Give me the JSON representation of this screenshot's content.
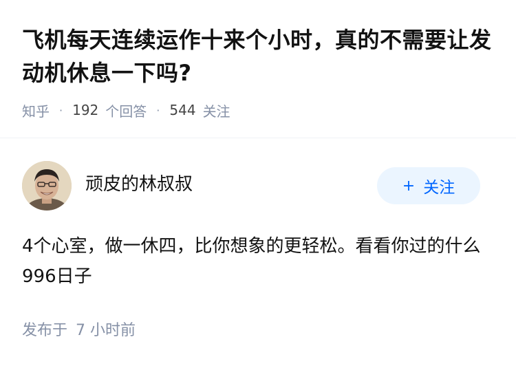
{
  "question": {
    "title": "飞机每天连续运作十来个小时，真的不需要让发动机休息一下吗?",
    "source": "知乎",
    "answers_count": "192",
    "answers_label": "个回答",
    "followers_count": "544",
    "followers_label": "关注"
  },
  "answer": {
    "author_name": "顽皮的林叔叔",
    "follow_button_label": "关注",
    "follow_button_icon": "plus-icon",
    "content": "4个心室，做一休四，比你想象的更轻松。看看你过的什么996日子",
    "time_prefix": "发布于",
    "time_value": "7 小时前"
  },
  "colors": {
    "accent": "#0066ff",
    "accent_bg": "#ebf5ff",
    "meta_text": "#8590a6",
    "title_text": "#121212"
  }
}
